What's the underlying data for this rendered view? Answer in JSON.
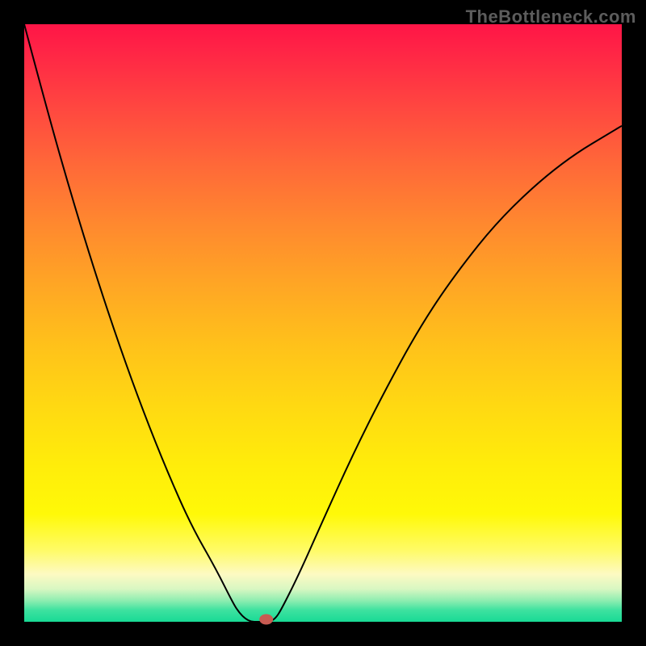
{
  "watermark": "TheBottleneck.com",
  "chart_data": {
    "type": "line",
    "title": "",
    "xlabel": "",
    "ylabel": "",
    "xlim": [
      0,
      100
    ],
    "ylim": [
      0,
      100
    ],
    "grid": false,
    "legend": false,
    "gradient_colors": {
      "top": "#ff1547",
      "mid": "#ffe80c",
      "bottom": "#18da95"
    },
    "series": [
      {
        "name": "curve",
        "x": [
          0,
          4,
          8,
          12,
          16,
          20,
          24,
          28,
          32,
          35,
          36,
          37,
          38,
          39,
          40,
          41,
          42,
          43,
          46,
          50,
          55,
          60,
          66,
          72,
          80,
          90,
          100
        ],
        "y": [
          100,
          85,
          71,
          58,
          46,
          35,
          25,
          16,
          9,
          3,
          1.5,
          0.5,
          0,
          0,
          0,
          0,
          0.5,
          2,
          8,
          17,
          28,
          38,
          49,
          58,
          68,
          77,
          83
        ]
      }
    ],
    "marker": {
      "x": 40.5,
      "y": 0,
      "color": "#c85b52"
    }
  }
}
